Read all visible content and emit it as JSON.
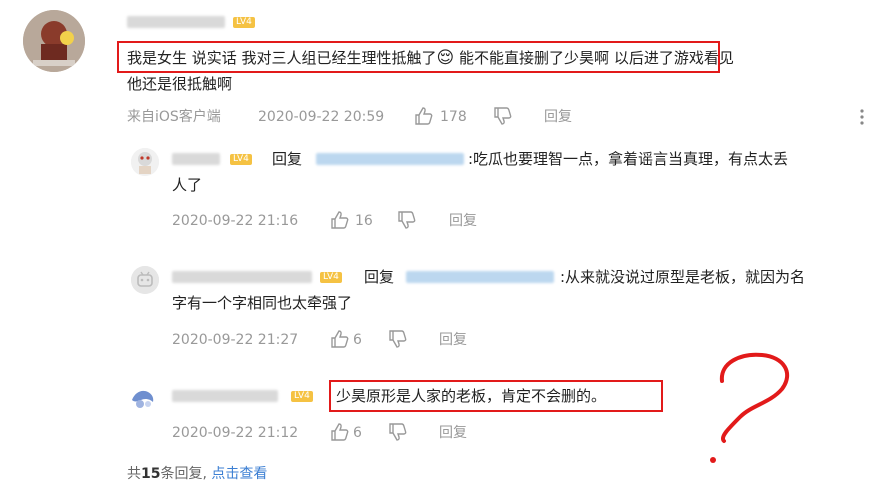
{
  "main_comment": {
    "level_badge": "LV4",
    "text_line1_hl1": "我是女生 说实话 我对三人组已经生理性抵触了",
    "emoji": "😌",
    "text_line1_hl2": " 能不能直接删了少昊啊",
    "text_line1_rest": " 以后进了游戏看见",
    "text_line2": "他还是很抵触啊",
    "source": "来自iOS客户端",
    "time": "2020-09-22 20:59",
    "likes": "178",
    "reply_label": "回复",
    "more_icon": "more-vertical-icon"
  },
  "replies": [
    {
      "level_badge": "LV4",
      "reply_word": "回复",
      "text_line1": ":吃瓜也要理智一点，拿着谣言当真理，有点太丢",
      "text_line2": "人了",
      "time": "2020-09-22 21:16",
      "likes": "16",
      "reply_label": "回复"
    },
    {
      "level_badge": "LV4",
      "reply_word": "回复",
      "text_line1": ":从来就没说过原型是老板，就因为名",
      "text_line2": "字有一个字相同也太牵强了",
      "time": "2020-09-22 21:27",
      "likes": "6",
      "reply_label": "回复"
    },
    {
      "level_badge": "LV4",
      "text_line1": "少昊原形是人家的老板，肯定不会删的。",
      "time": "2020-09-22 21:12",
      "likes": "6",
      "reply_label": "回复"
    }
  ],
  "footer": {
    "prefix": "共",
    "count": "15",
    "suffix": "条回复, ",
    "link": "点击查看"
  },
  "annotation": {
    "question_mark": "?",
    "highlight_color": "#e21a1a"
  }
}
